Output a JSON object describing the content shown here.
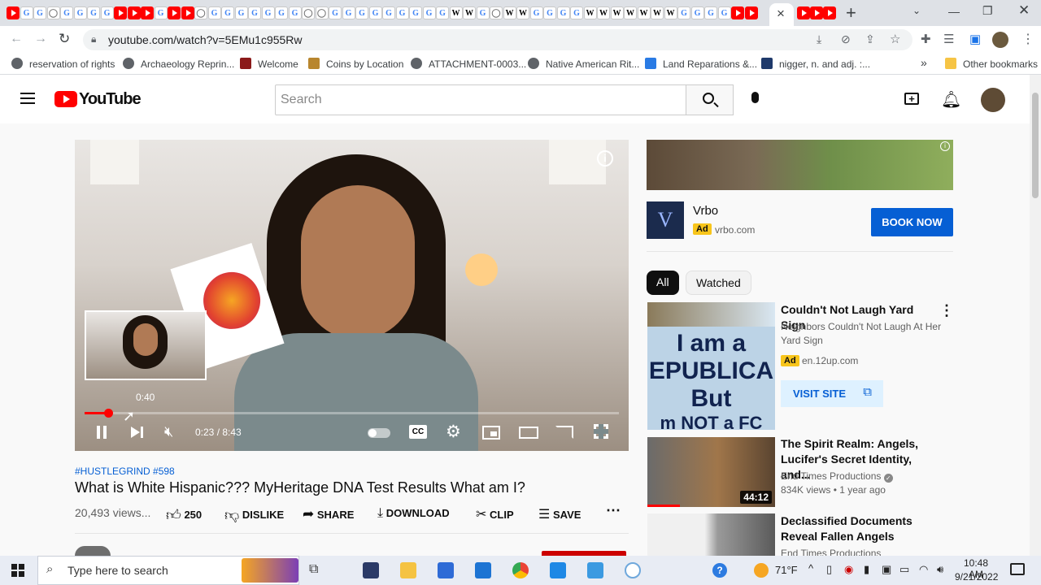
{
  "browser": {
    "active_tab_close": "×",
    "new_tab": "+",
    "url": "youtube.com/watch?v=5EMu1c955Rw",
    "bookmarks": [
      "reservation of rights",
      "Archaeology Reprin...",
      "Welcome",
      "Coins by Location",
      "ATTACHMENT-0003...",
      "Native American Rit...",
      "Land Reparations &...",
      "nigger, n. and adj. :..."
    ],
    "bookmarks_more": "»",
    "other_bookmarks": "Other bookmarks"
  },
  "youtube": {
    "logo_text": "YouTube",
    "search_placeholder": "Search"
  },
  "player": {
    "preview_time": "0:40",
    "time": "0:23 / 8:43",
    "progress_fraction": 0.044,
    "cc": "CC"
  },
  "video": {
    "tags": "#HUSTLEGRIND #598",
    "title": "What is White Hispanic??? MyHeritage DNA Test Results What am I?",
    "views": "20,493 views...",
    "likes": "250",
    "dislike": "DISLIKE",
    "share": "SHARE",
    "download": "DOWNLOAD",
    "clip": "CLIP",
    "save": "SAVE"
  },
  "ad": {
    "brand": "Vrbo",
    "ad_badge": "Ad",
    "domain": "vrbo.com",
    "cta": "BOOK NOW"
  },
  "chips": [
    "All",
    "Watched"
  ],
  "recommendations": [
    {
      "title": "Couldn't Not Laugh Yard Sign",
      "sub": "Neighbors Couldn't Not Laugh At Her Yard Sign",
      "ad_badge": "Ad",
      "domain": "en.12up.com",
      "cta": "VISIT SITE",
      "thumb_text": [
        "I am a",
        "EPUBLICA",
        "But",
        "m NOT a FC"
      ]
    },
    {
      "title": "The Spirit Realm: Angels, Lucifer's Secret Identity, and...",
      "channel": "End Times Productions",
      "meta": "834K views • 1 year ago",
      "duration": "44:12"
    },
    {
      "title": "Declassified Documents Reveal Fallen Angels",
      "channel": "End Times Productions"
    }
  ],
  "taskbar": {
    "search_placeholder": "Type here to search",
    "weather": "71°F",
    "time": "10:48 AM",
    "date": "9/21/2022"
  }
}
